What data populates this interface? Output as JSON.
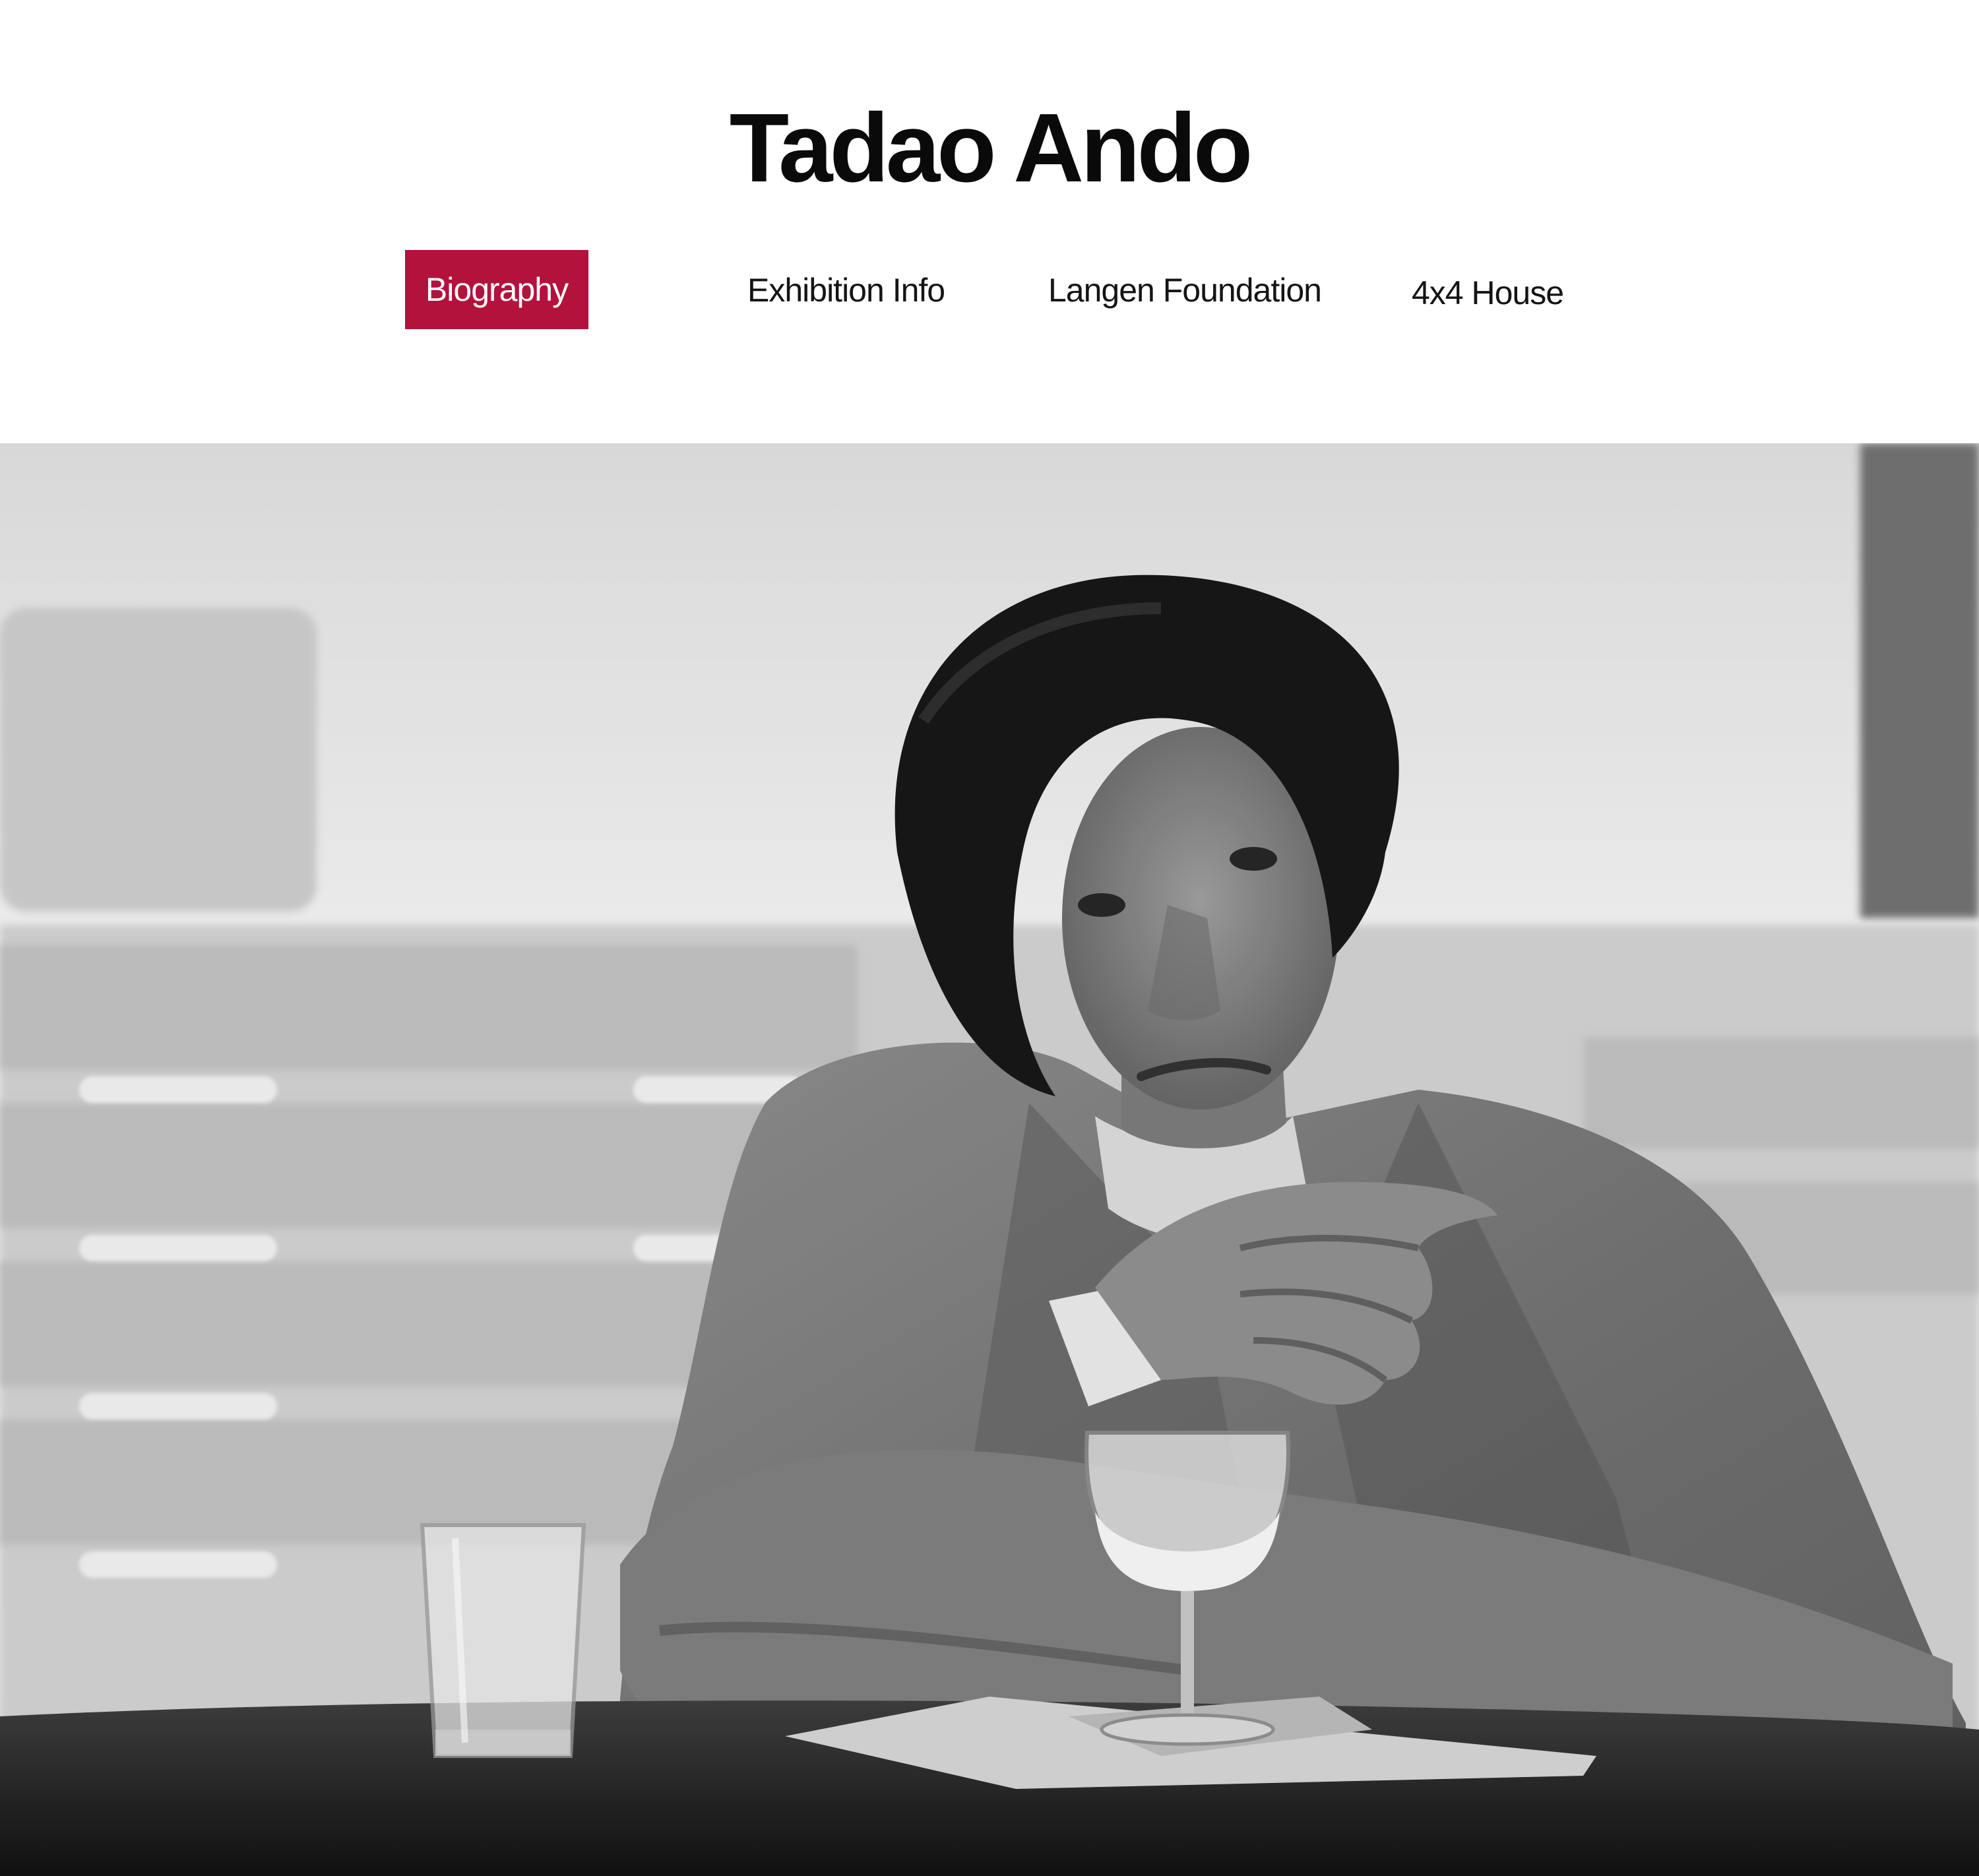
{
  "header": {
    "title": "Tadao Ando"
  },
  "nav": {
    "items": [
      {
        "label": "Biography",
        "active": true
      },
      {
        "label": "Exhibition Info",
        "active": false
      },
      {
        "label": "Langen Foundation",
        "active": false
      },
      {
        "label": "4x4 House",
        "active": false
      }
    ]
  },
  "colors": {
    "accent": "#b3123c",
    "text": "#0a0a0a",
    "background": "#ffffff"
  },
  "photo": {
    "style": "black-and-white"
  }
}
